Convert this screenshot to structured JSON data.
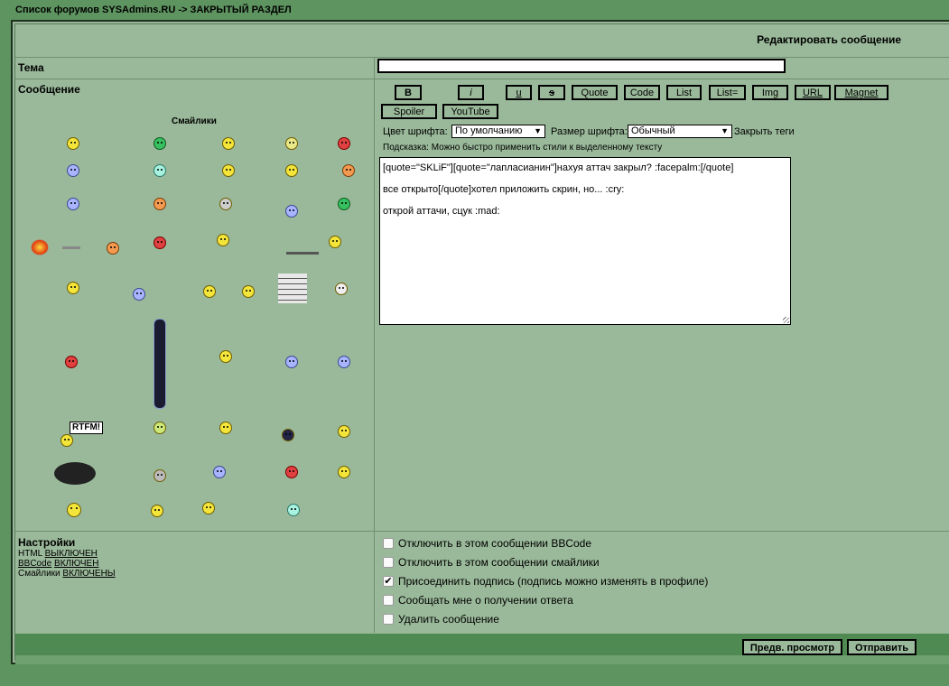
{
  "breadcrumb": {
    "forum_list": "Список форумов SYSAdmins.RU",
    "separator": "->",
    "section": "ЗАКРЫТЫЙ РАЗДЕЛ"
  },
  "header": {
    "title": "Редактировать сообщение"
  },
  "subject": {
    "label": "Тема",
    "value": ""
  },
  "message": {
    "label": "Сообщение"
  },
  "smilies": {
    "title": "Смайлики"
  },
  "toolbar": {
    "bold": "B",
    "italic": "i",
    "underline": "u",
    "strike": "s",
    "quote": "Quote",
    "code": "Code",
    "list": "List",
    "list_eq": "List=",
    "img": "Img",
    "url": "URL",
    "magnet": "Magnet",
    "spoiler": "Spoiler",
    "youtube": "YouTube"
  },
  "font": {
    "color_label": "Цвет шрифта:",
    "color_value": "По умолчанию",
    "size_label": "Размер шрифта:",
    "size_value": "Обычный",
    "close_tags": "Закрыть теги"
  },
  "hint": "Подсказка: Можно быстро применить стили к выделенному тексту",
  "body_lines": [
    "[quote=\"SKLiF\"][quote=\"лапласианин\"]нахуя аттач закрыл? :facepalm:[/quote]",
    "все открыто[/quote]хотел приложить скрин, но... :cry:",
    "открой аттачи, сцук :mad:"
  ],
  "settings": {
    "title": "Настройки",
    "html_label": "HTML",
    "html_state": "ВЫКЛЮЧЕН",
    "bbcode_label": "BBCode",
    "bbcode_state": "ВКЛЮЧЕН",
    "smilies_label": "Смайлики",
    "smilies_state": "ВКЛЮЧЕНЫ"
  },
  "options": [
    {
      "label": "Отключить в этом сообщении BBCode",
      "checked": false
    },
    {
      "label": "Отключить в этом сообщении смайлики",
      "checked": false
    },
    {
      "label": "Присоединить подпись (подпись можно изменять в профиле)",
      "checked": true
    },
    {
      "label": "Сообщать мне о получении ответа",
      "checked": false
    },
    {
      "label": "Удалить сообщение",
      "checked": false
    }
  ],
  "buttons": {
    "preview": "Предв. просмотр",
    "submit": "Отправить"
  },
  "extras": {
    "rtfm": "RTFM!"
  }
}
